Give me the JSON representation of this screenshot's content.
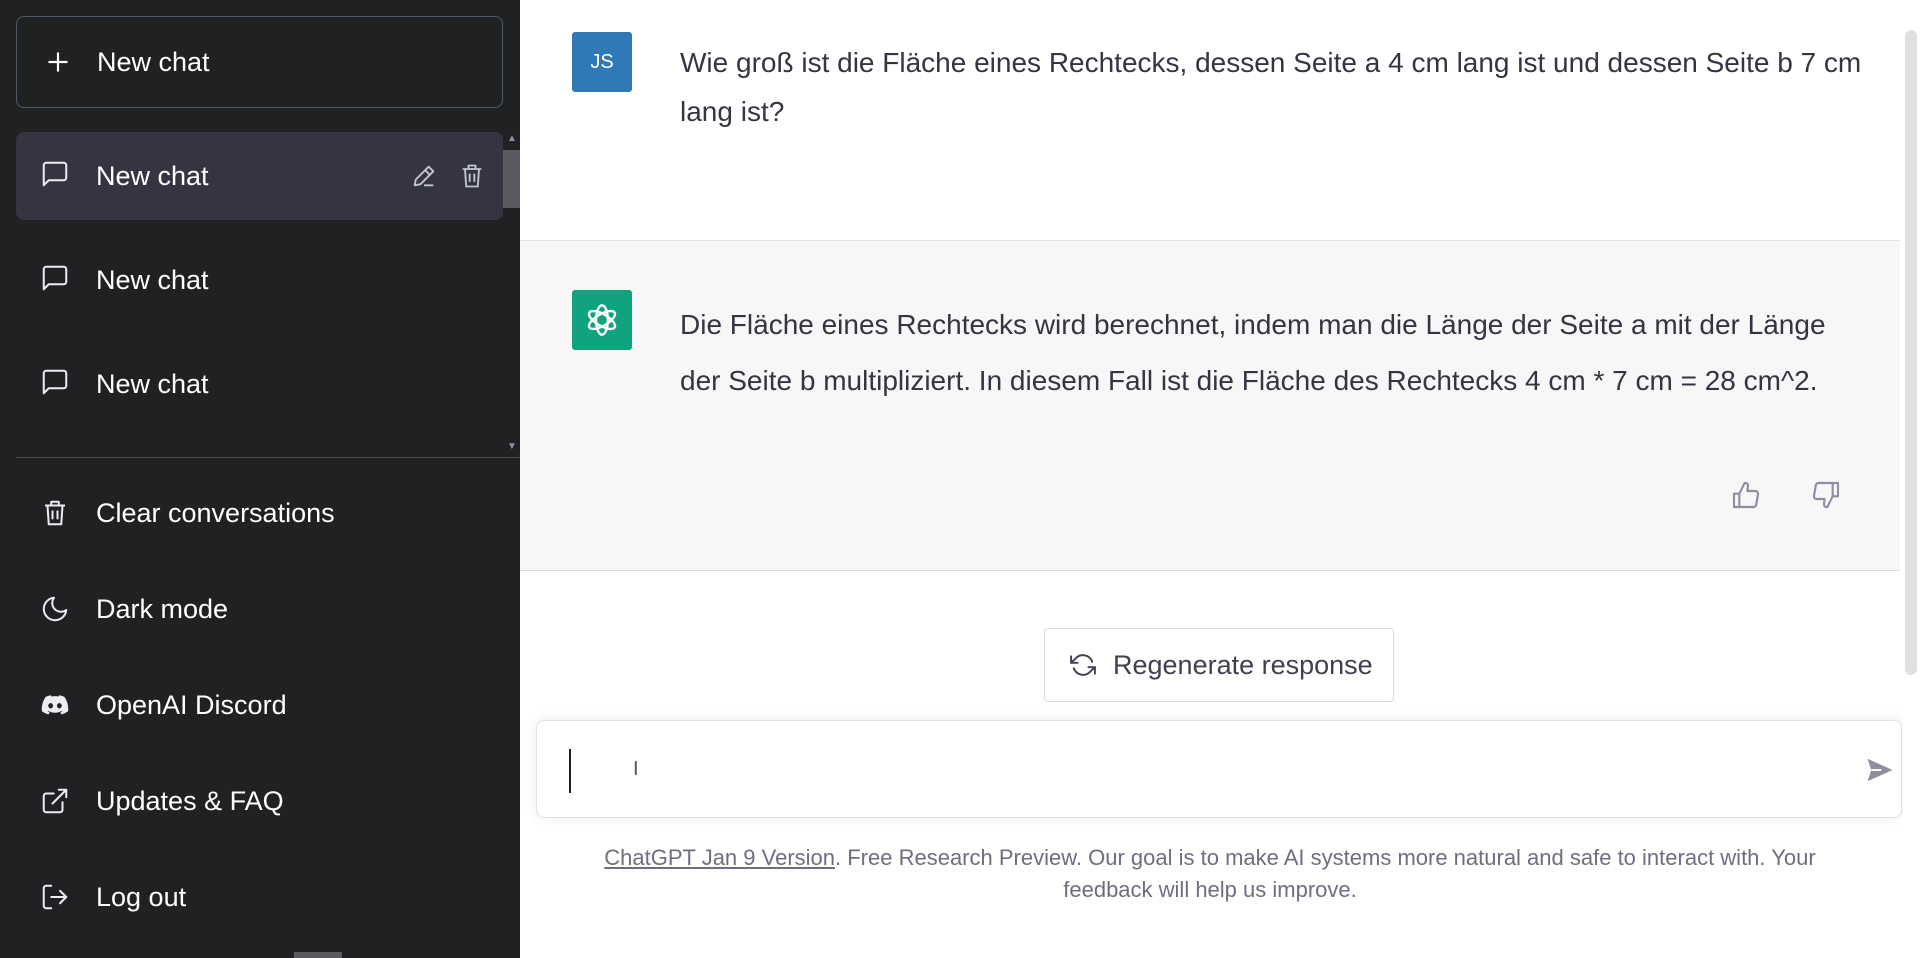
{
  "sidebar": {
    "new_chat_label": "New chat",
    "history": [
      {
        "label": "New chat",
        "active": true
      },
      {
        "label": "New chat",
        "active": false
      },
      {
        "label": "New chat",
        "active": false
      }
    ],
    "menu": {
      "clear_label": "Clear conversations",
      "dark_mode_label": "Dark mode",
      "discord_label": "OpenAI Discord",
      "updates_label": "Updates & FAQ",
      "logout_label": "Log out"
    }
  },
  "conversation": {
    "user": {
      "avatar_initials": "JS",
      "text": "Wie groß ist die Fläche eines Rechtecks, dessen Seite a 4 cm lang ist und dessen Seite b 7 cm lang ist?"
    },
    "assistant": {
      "text": "Die Fläche eines Rechtecks wird berechnet, indem man die Länge der Seite a mit der Länge der Seite b multipliziert. In diesem Fall ist die Fläche des Rechtecks 4 cm * 7 cm = 28 cm^2."
    }
  },
  "regenerate_label": "Regenerate response",
  "input": {
    "value": "",
    "placeholder": ""
  },
  "footer": {
    "link_text": "ChatGPT Jan 9 Version",
    "text": ". Free Research Preview. Our goal is to make AI systems more natural and safe to interact with. Your feedback will help us improve."
  },
  "icons": {
    "new_chat": "plus-icon",
    "chat_item": "message-icon",
    "edit": "pencil-icon",
    "delete": "trash-icon",
    "clear": "trash-icon",
    "dark_mode": "moon-icon",
    "discord": "discord-icon",
    "updates": "external-link-icon",
    "logout": "logout-icon",
    "bot_avatar": "openai-logo-icon",
    "regenerate": "refresh-icon",
    "send": "send-icon",
    "thumbs_up": "thumbs-up-icon",
    "thumbs_down": "thumbs-down-icon"
  },
  "colors": {
    "sidebar_bg": "#202123",
    "active_item_bg": "#343541",
    "user_avatar_bg": "#2f79b7",
    "bot_avatar_bg": "#10a37f",
    "assistant_row_bg": "#f7f7f8"
  }
}
